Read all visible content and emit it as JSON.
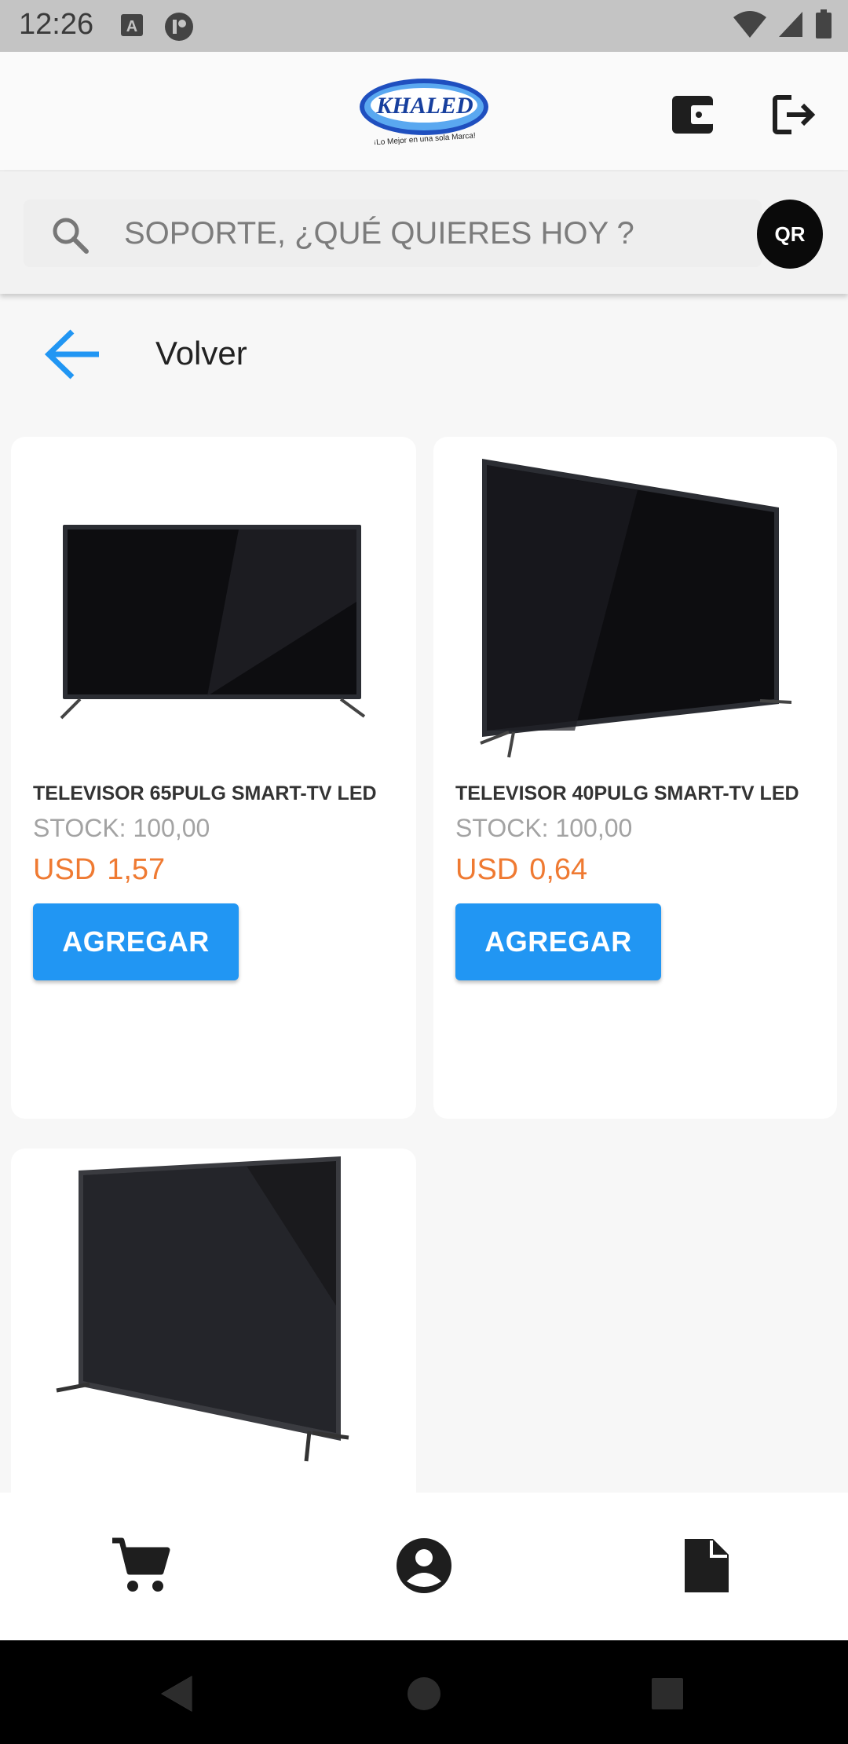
{
  "status_bar": {
    "time": "12:26",
    "left_icons": [
      "a-text-icon",
      "accessibility-icon"
    ],
    "right_icons": [
      "wifi-icon",
      "signal-icon",
      "battery-icon"
    ]
  },
  "header": {
    "logo_text": "KHALED",
    "logo_tagline": "¡Lo Mejor en una sola Marca!",
    "icons": [
      "wallet-icon",
      "logout-icon"
    ]
  },
  "search": {
    "placeholder": "SOPORTE, ¿QUÉ QUIERES HOY ?",
    "qr_label": "QR"
  },
  "back": {
    "label": "Volver"
  },
  "products": [
    {
      "name": "TELEVISOR 65PULG SMART-TV LED",
      "stock": "STOCK: 100,00",
      "currency": "USD",
      "price": "1,57",
      "button": "AGREGAR"
    },
    {
      "name": "TELEVISOR 40PULG SMART-TV LED",
      "stock": "STOCK: 100,00",
      "currency": "USD",
      "price": "0,64",
      "button": "AGREGAR"
    },
    {
      "name": "",
      "stock": "",
      "currency": "",
      "price": "",
      "button": ""
    }
  ],
  "colors": {
    "accent": "#2196f3",
    "price": "#ef7a32",
    "stock": "#a3a3a3",
    "qr_bg": "#0a0a0a"
  },
  "bottom_nav": [
    "cart-icon",
    "account-icon",
    "document-icon"
  ],
  "system_nav": [
    "back-triangle-icon",
    "home-circle-icon",
    "recents-square-icon"
  ]
}
